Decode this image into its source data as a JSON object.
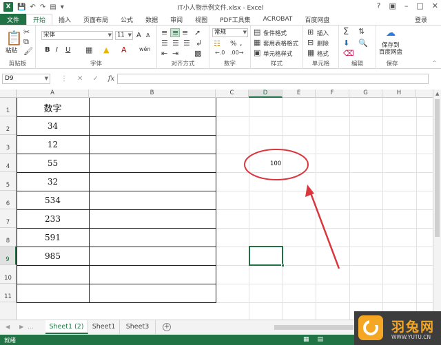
{
  "window": {
    "title": "IT小人物示例文件.xlsx - Excel",
    "login": "登录",
    "app_icon": "X"
  },
  "tabs": [
    "文件",
    "开始",
    "插入",
    "页面布局",
    "公式",
    "数据",
    "审阅",
    "视图",
    "PDF工具集",
    "ACROBAT",
    "百度网盘"
  ],
  "active_tab": "开始",
  "ribbon": {
    "clipboard": {
      "paste": "粘贴",
      "label": "剪贴板"
    },
    "font": {
      "name": "宋体",
      "size": "11",
      "label": "字体",
      "bold": "B",
      "italic": "I",
      "underline": "U",
      "grow": "A",
      "shrink": "A",
      "font_color": "A",
      "wen": "wén"
    },
    "alignment": {
      "label": "对齐方式"
    },
    "number": {
      "format": "常规",
      "percent": "%",
      "comma": ",",
      "label": "数字"
    },
    "styles": {
      "conditional": "条件格式",
      "table": "套用表格格式",
      "cell": "单元格样式",
      "label": "样式"
    },
    "cells": {
      "insert": "插入",
      "delete": "删除",
      "format": "格式",
      "label": "单元格"
    },
    "editing": {
      "label": "编辑"
    },
    "save": {
      "line1": "保存到",
      "line2": "百度网盘",
      "label": "保存"
    }
  },
  "formula_bar": {
    "name_box": "D9",
    "fx": "fx",
    "content": ""
  },
  "columns": [
    "A",
    "B",
    "C",
    "D",
    "E",
    "F",
    "G",
    "H"
  ],
  "rows": [
    "1",
    "2",
    "3",
    "4",
    "5",
    "6",
    "7",
    "8",
    "9",
    "10",
    "11"
  ],
  "active_cell": {
    "col": "D",
    "row": "9"
  },
  "column_a_values": [
    "数字",
    "34",
    "12",
    "55",
    "32",
    "534",
    "233",
    "591",
    "985",
    "",
    ""
  ],
  "cell_d4": "100",
  "sheets": [
    "Sheet1 (2)",
    "Sheet1",
    "Sheet3"
  ],
  "active_sheet": "Sheet1 (2)",
  "status": {
    "ready": "就绪"
  },
  "watermark": {
    "title": "羽兔网",
    "url": "WWW.YUTU.CN"
  },
  "annotation_color": "#d9363e",
  "accent_color": "#217346"
}
